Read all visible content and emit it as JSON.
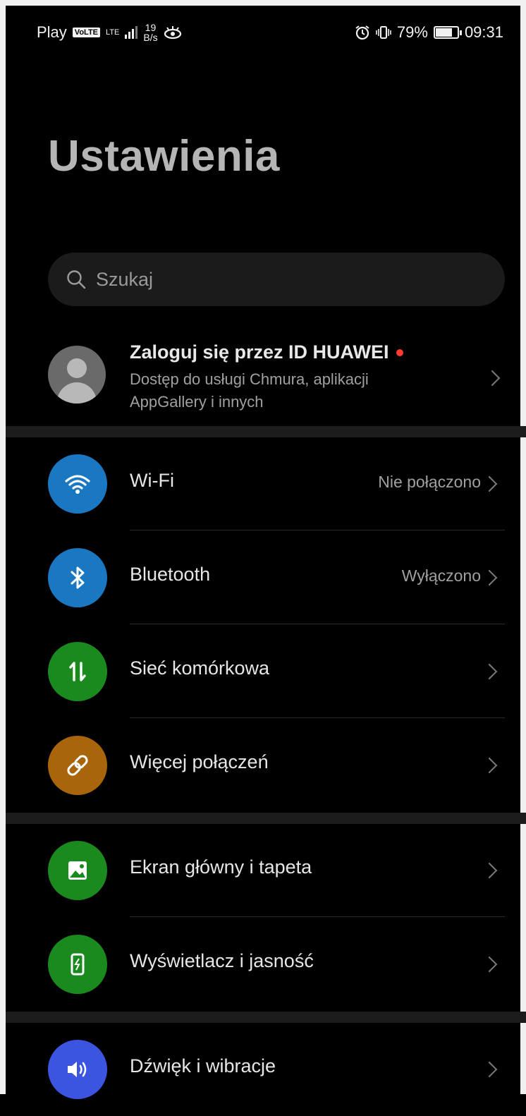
{
  "status_bar": {
    "carrier": "Play",
    "volte": "VoLTE",
    "network": "LTE",
    "speed_value": "19",
    "speed_unit": "B/s",
    "battery_percent": "79%",
    "battery_level": 0.79,
    "time": "09:31"
  },
  "page": {
    "title": "Ustawienia"
  },
  "search": {
    "placeholder": "Szukaj"
  },
  "account": {
    "title": "Zaloguj się przez ID HUAWEI",
    "subtitle": "Dostęp do usługi Chmura, aplikacji AppGallery i innych"
  },
  "items": [
    {
      "label": "Wi-Fi",
      "value": "Nie połączono",
      "icon": "wifi-icon",
      "color": "#1a78c2"
    },
    {
      "label": "Bluetooth",
      "value": "Wyłączono",
      "icon": "bluetooth-icon",
      "color": "#1a78c2"
    },
    {
      "label": "Sieć komórkowa",
      "value": "",
      "icon": "mobile-data-icon",
      "color": "#1a8a1f"
    },
    {
      "label": "Więcej połączeń",
      "value": "",
      "icon": "link-icon",
      "color": "#a8650c"
    },
    {
      "label": "Ekran główny i tapeta",
      "value": "",
      "icon": "wallpaper-icon",
      "color": "#1a8a1f"
    },
    {
      "label": "Wyświetlacz i jasność",
      "value": "",
      "icon": "display-brightness-icon",
      "color": "#1a8a1f"
    },
    {
      "label": "Dźwięk i wibracje",
      "value": "",
      "icon": "sound-icon",
      "color": "#3b55e0"
    }
  ]
}
